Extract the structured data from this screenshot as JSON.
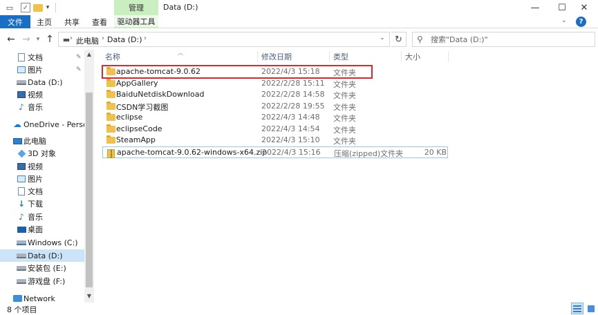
{
  "window": {
    "title": "Data (D:)",
    "context_tab": "管理"
  },
  "ribbon": {
    "tabs": [
      "文件",
      "主页",
      "共享",
      "查看",
      "驱动器工具"
    ]
  },
  "address": {
    "parts": [
      "此电脑",
      "Data (D:)"
    ]
  },
  "search": {
    "placeholder": "搜索\"Data (D:)\""
  },
  "nav": {
    "items": [
      {
        "label": "文档",
        "icon": "document-icon",
        "pinned": true
      },
      {
        "label": "图片",
        "icon": "picture-icon",
        "pinned": true
      },
      {
        "label": "Data (D:)",
        "icon": "drive-icon",
        "pinned": false
      },
      {
        "label": "视频",
        "icon": "video-icon",
        "pinned": false
      },
      {
        "label": "音乐",
        "icon": "music-icon",
        "pinned": false
      },
      {
        "label": "OneDrive - Personal",
        "icon": "onedrive-icon",
        "pinned": false
      },
      {
        "label": "此电脑",
        "icon": "this-pc-icon",
        "pinned": false
      },
      {
        "label": "3D 对象",
        "icon": "3d-objects-icon",
        "pinned": false
      },
      {
        "label": "视频",
        "icon": "video-icon",
        "pinned": false
      },
      {
        "label": "图片",
        "icon": "picture-icon",
        "pinned": false
      },
      {
        "label": "文档",
        "icon": "document-icon",
        "pinned": false
      },
      {
        "label": "下载",
        "icon": "download-icon",
        "pinned": false
      },
      {
        "label": "音乐",
        "icon": "music-icon",
        "pinned": false
      },
      {
        "label": "桌面",
        "icon": "desktop-icon",
        "pinned": false
      },
      {
        "label": "Windows (C:)",
        "icon": "windows-drive-icon",
        "pinned": false
      },
      {
        "label": "Data (D:)",
        "icon": "drive-icon",
        "pinned": false,
        "selected": true
      },
      {
        "label": "安装包 (E:)",
        "icon": "drive-icon",
        "pinned": false
      },
      {
        "label": "游戏盘 (F:)",
        "icon": "drive-icon",
        "pinned": false
      },
      {
        "label": "Network",
        "icon": "network-icon",
        "pinned": false
      }
    ]
  },
  "columns": {
    "name": "名称",
    "date": "修改日期",
    "type": "类型",
    "size": "大小"
  },
  "files": [
    {
      "name": "apache-tomcat-9.0.62",
      "date": "2022/4/3 15:18",
      "type": "文件夹",
      "size": "",
      "kind": "folder"
    },
    {
      "name": "AppGallery",
      "date": "2022/2/28 15:11",
      "type": "文件夹",
      "size": "",
      "kind": "folder"
    },
    {
      "name": "BaiduNetdiskDownload",
      "date": "2022/2/28 14:58",
      "type": "文件夹",
      "size": "",
      "kind": "folder"
    },
    {
      "name": "CSDN学习截图",
      "date": "2022/2/28 19:55",
      "type": "文件夹",
      "size": "",
      "kind": "folder"
    },
    {
      "name": "eclipse",
      "date": "2022/4/3 14:48",
      "type": "文件夹",
      "size": "",
      "kind": "folder"
    },
    {
      "name": "eclipseCode",
      "date": "2022/4/3 14:54",
      "type": "文件夹",
      "size": "",
      "kind": "folder"
    },
    {
      "name": "SteamApp",
      "date": "2022/4/3 15:10",
      "type": "文件夹",
      "size": "",
      "kind": "folder"
    },
    {
      "name": "apache-tomcat-9.0.62-windows-x64.zip",
      "date": "2022/4/3 15:16",
      "type": "压缩(zipped)文件夹",
      "size": "20 KB",
      "kind": "zip"
    }
  ],
  "status": {
    "count": "8 个项目"
  },
  "colors": {
    "accent": "#1a6fc4",
    "context_tab": "#c9efc0",
    "selection": "#cce4f7",
    "highlight_box": "#e0262a"
  }
}
